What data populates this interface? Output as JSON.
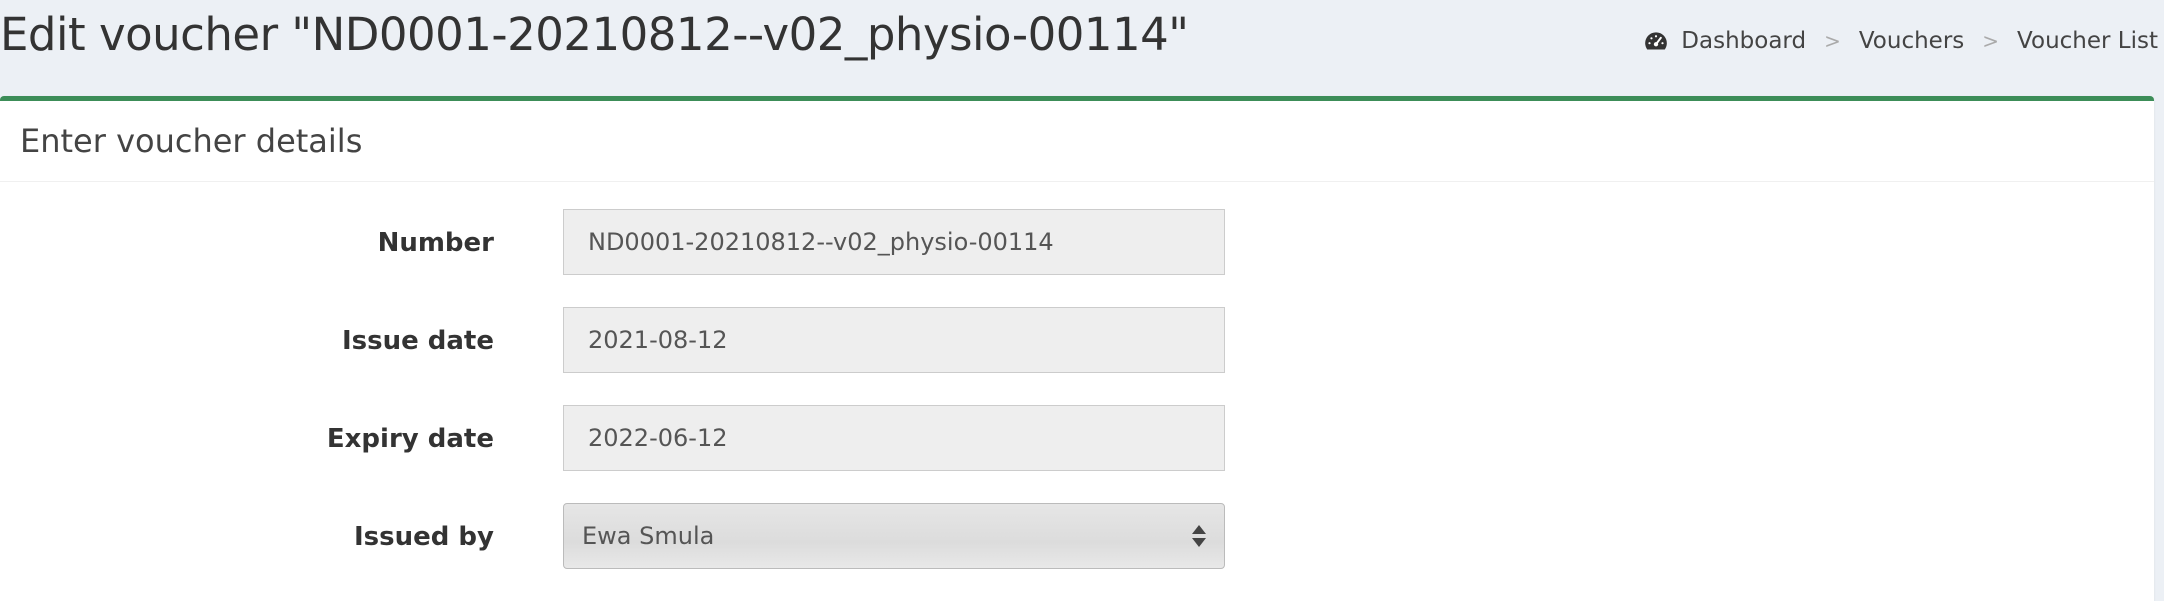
{
  "page": {
    "title": "Edit voucher \"ND0001-20210812--v02_physio-00114\""
  },
  "breadcrumb": {
    "icon": "dashboard-icon",
    "items": [
      "Dashboard",
      "Vouchers",
      "Voucher List"
    ],
    "separator": ">"
  },
  "box": {
    "title": "Enter voucher details",
    "accent_color": "#3c8d58"
  },
  "form": {
    "number": {
      "label": "Number",
      "value": "ND0001-20210812--v02_physio-00114"
    },
    "issue_date": {
      "label": "Issue date",
      "value": "2021-08-12"
    },
    "expiry_date": {
      "label": "Expiry date",
      "value": "2022-06-12"
    },
    "issued_by": {
      "label": "Issued by",
      "value": "Ewa Smula"
    }
  }
}
